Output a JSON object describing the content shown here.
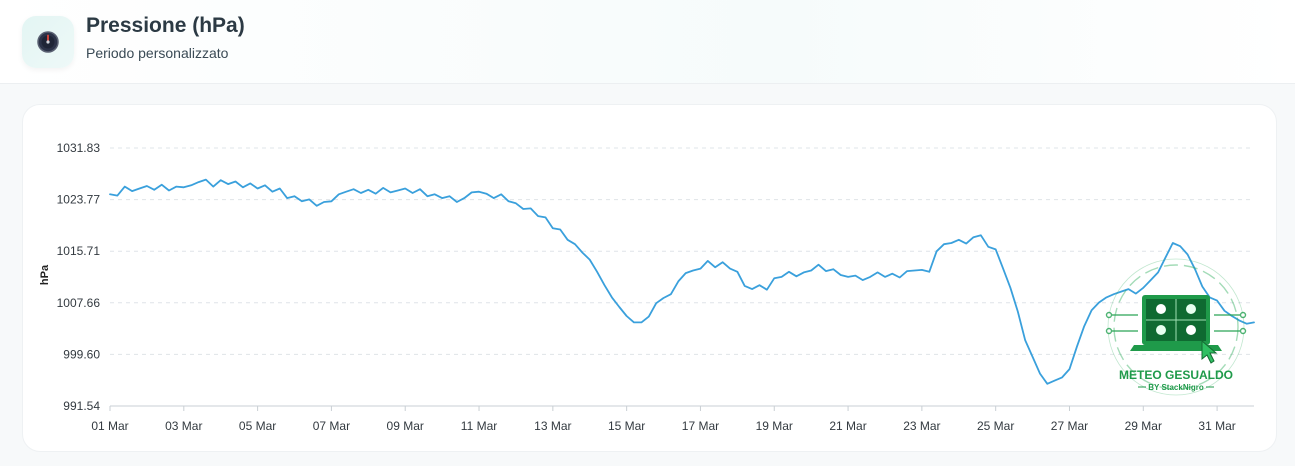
{
  "header": {
    "title": "Pressione (hPa)",
    "subtitle": "Periodo personalizzato",
    "icon": "gauge-icon"
  },
  "watermark": {
    "title": "METEO GESUALDO",
    "subtitle": "BY StackNigro"
  },
  "colors": {
    "line": "#3aa0dc",
    "grid": "#dfe4e8",
    "accent": "#1f9a4a"
  },
  "chart_data": {
    "type": "line",
    "ylabel": "hPa",
    "ylim": [
      991.54,
      1031.83
    ],
    "yticks": [
      "1031.83",
      "1023.77",
      "1015.71",
      "1007.66",
      "999.60",
      "991.54"
    ],
    "xlim": [
      1,
      32
    ],
    "xticks": [
      {
        "day": 1,
        "label": "01 Mar"
      },
      {
        "day": 3,
        "label": "03 Mar"
      },
      {
        "day": 5,
        "label": "05 Mar"
      },
      {
        "day": 7,
        "label": "07 Mar"
      },
      {
        "day": 9,
        "label": "09 Mar"
      },
      {
        "day": 11,
        "label": "11 Mar"
      },
      {
        "day": 13,
        "label": "13 Mar"
      },
      {
        "day": 15,
        "label": "15 Mar"
      },
      {
        "day": 17,
        "label": "17 Mar"
      },
      {
        "day": 19,
        "label": "19 Mar"
      },
      {
        "day": 21,
        "label": "21 Mar"
      },
      {
        "day": 23,
        "label": "23 Mar"
      },
      {
        "day": 25,
        "label": "25 Mar"
      },
      {
        "day": 27,
        "label": "27 Mar"
      },
      {
        "day": 29,
        "label": "29 Mar"
      },
      {
        "day": 31,
        "label": "31 Mar"
      }
    ],
    "grid": true,
    "series": [
      {
        "points": [
          [
            1.0,
            1024.6
          ],
          [
            1.2,
            1024.4
          ],
          [
            1.4,
            1025.8
          ],
          [
            1.6,
            1025.1
          ],
          [
            1.8,
            1025.5
          ],
          [
            2.0,
            1025.9
          ],
          [
            2.2,
            1025.3
          ],
          [
            2.4,
            1026.1
          ],
          [
            2.6,
            1025.2
          ],
          [
            2.8,
            1025.8
          ],
          [
            3.0,
            1025.7
          ],
          [
            3.2,
            1026.0
          ],
          [
            3.4,
            1026.5
          ],
          [
            3.6,
            1026.9
          ],
          [
            3.8,
            1025.8
          ],
          [
            4.0,
            1026.8
          ],
          [
            4.2,
            1026.2
          ],
          [
            4.4,
            1026.6
          ],
          [
            4.6,
            1025.7
          ],
          [
            4.8,
            1026.3
          ],
          [
            5.0,
            1025.5
          ],
          [
            5.2,
            1026.0
          ],
          [
            5.4,
            1025.0
          ],
          [
            5.6,
            1025.5
          ],
          [
            5.8,
            1024.0
          ],
          [
            6.0,
            1024.3
          ],
          [
            6.2,
            1023.5
          ],
          [
            6.4,
            1023.8
          ],
          [
            6.6,
            1022.8
          ],
          [
            6.8,
            1023.4
          ],
          [
            7.0,
            1023.5
          ],
          [
            7.2,
            1024.6
          ],
          [
            7.4,
            1025.0
          ],
          [
            7.6,
            1025.4
          ],
          [
            7.8,
            1024.8
          ],
          [
            8.0,
            1025.3
          ],
          [
            8.2,
            1024.7
          ],
          [
            8.4,
            1025.6
          ],
          [
            8.6,
            1024.9
          ],
          [
            8.8,
            1025.2
          ],
          [
            9.0,
            1025.5
          ],
          [
            9.2,
            1024.8
          ],
          [
            9.4,
            1025.4
          ],
          [
            9.6,
            1024.3
          ],
          [
            9.8,
            1024.6
          ],
          [
            10.0,
            1024.0
          ],
          [
            10.2,
            1024.3
          ],
          [
            10.4,
            1023.4
          ],
          [
            10.6,
            1024.0
          ],
          [
            10.8,
            1024.9
          ],
          [
            11.0,
            1025.0
          ],
          [
            11.2,
            1024.7
          ],
          [
            11.4,
            1024.0
          ],
          [
            11.6,
            1024.6
          ],
          [
            11.8,
            1023.5
          ],
          [
            12.0,
            1023.2
          ],
          [
            12.2,
            1022.3
          ],
          [
            12.4,
            1022.4
          ],
          [
            12.6,
            1021.2
          ],
          [
            12.8,
            1021.0
          ],
          [
            13.0,
            1019.3
          ],
          [
            13.2,
            1019.1
          ],
          [
            13.4,
            1017.5
          ],
          [
            13.6,
            1016.8
          ],
          [
            13.8,
            1015.5
          ],
          [
            14.0,
            1014.4
          ],
          [
            14.2,
            1012.5
          ],
          [
            14.4,
            1010.4
          ],
          [
            14.6,
            1008.5
          ],
          [
            14.8,
            1007.0
          ],
          [
            15.0,
            1005.6
          ],
          [
            15.2,
            1004.6
          ],
          [
            15.4,
            1004.6
          ],
          [
            15.6,
            1005.5
          ],
          [
            15.8,
            1007.6
          ],
          [
            16.0,
            1008.4
          ],
          [
            16.2,
            1009.0
          ],
          [
            16.4,
            1011.0
          ],
          [
            16.6,
            1012.3
          ],
          [
            16.8,
            1012.7
          ],
          [
            17.0,
            1013.0
          ],
          [
            17.2,
            1014.2
          ],
          [
            17.4,
            1013.2
          ],
          [
            17.6,
            1014.0
          ],
          [
            17.8,
            1013.0
          ],
          [
            18.0,
            1012.5
          ],
          [
            18.2,
            1010.3
          ],
          [
            18.4,
            1009.8
          ],
          [
            18.6,
            1010.4
          ],
          [
            18.8,
            1009.7
          ],
          [
            19.0,
            1011.5
          ],
          [
            19.2,
            1011.7
          ],
          [
            19.4,
            1012.5
          ],
          [
            19.6,
            1011.8
          ],
          [
            19.8,
            1012.4
          ],
          [
            20.0,
            1012.7
          ],
          [
            20.2,
            1013.6
          ],
          [
            20.4,
            1012.6
          ],
          [
            20.6,
            1012.9
          ],
          [
            20.8,
            1012.0
          ],
          [
            21.0,
            1011.7
          ],
          [
            21.2,
            1011.9
          ],
          [
            21.4,
            1011.2
          ],
          [
            21.6,
            1011.7
          ],
          [
            21.8,
            1012.4
          ],
          [
            22.0,
            1011.7
          ],
          [
            22.2,
            1012.2
          ],
          [
            22.4,
            1011.6
          ],
          [
            22.6,
            1012.6
          ],
          [
            22.8,
            1012.7
          ],
          [
            23.0,
            1012.8
          ],
          [
            23.2,
            1012.5
          ],
          [
            23.4,
            1015.7
          ],
          [
            23.6,
            1016.8
          ],
          [
            23.8,
            1017.0
          ],
          [
            24.0,
            1017.5
          ],
          [
            24.2,
            1016.9
          ],
          [
            24.4,
            1017.9
          ],
          [
            24.6,
            1018.2
          ],
          [
            24.8,
            1016.4
          ],
          [
            25.0,
            1016.0
          ],
          [
            25.2,
            1013.0
          ],
          [
            25.4,
            1010.0
          ],
          [
            25.6,
            1006.3
          ],
          [
            25.8,
            1001.8
          ],
          [
            26.0,
            999.2
          ],
          [
            26.2,
            996.6
          ],
          [
            26.4,
            995.0
          ],
          [
            26.6,
            995.5
          ],
          [
            26.8,
            996.0
          ],
          [
            27.0,
            997.3
          ],
          [
            27.2,
            1000.8
          ],
          [
            27.4,
            1004.0
          ],
          [
            27.6,
            1006.5
          ],
          [
            27.8,
            1007.7
          ],
          [
            28.0,
            1008.5
          ],
          [
            28.2,
            1009.0
          ],
          [
            28.4,
            1009.4
          ],
          [
            28.6,
            1009.8
          ],
          [
            28.8,
            1009.1
          ],
          [
            29.0,
            1010.0
          ],
          [
            29.2,
            1011.2
          ],
          [
            29.4,
            1012.4
          ],
          [
            29.6,
            1014.7
          ],
          [
            29.8,
            1017.0
          ],
          [
            30.0,
            1016.5
          ],
          [
            30.2,
            1015.2
          ],
          [
            30.4,
            1012.9
          ],
          [
            30.6,
            1010.2
          ],
          [
            30.8,
            1008.5
          ],
          [
            31.0,
            1008.0
          ],
          [
            31.2,
            1006.4
          ],
          [
            31.4,
            1005.6
          ],
          [
            31.6,
            1004.9
          ],
          [
            31.8,
            1004.4
          ],
          [
            32.0,
            1004.6
          ]
        ]
      }
    ]
  }
}
